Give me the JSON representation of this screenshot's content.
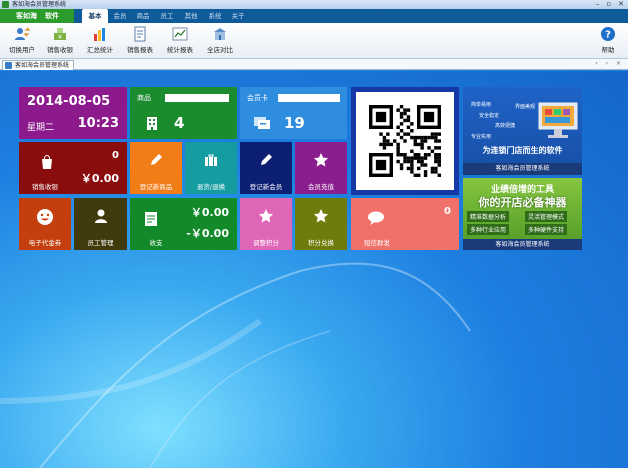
{
  "window": {
    "title": "客如海会员管理系统",
    "controls": [
      "–",
      "▫",
      "✕"
    ]
  },
  "brand": {
    "name": "客如海",
    "suffix": "软件"
  },
  "menu": [
    "基本",
    "会员",
    "商品",
    "员工",
    "其他",
    "系统",
    "关于"
  ],
  "toolbar": {
    "items": [
      "切换用户",
      "销售收银",
      "汇总统计",
      "销售报表",
      "统计报表",
      "全店对比"
    ],
    "help": "帮助"
  },
  "doc_tab": {
    "label": "客如海会员管理系统",
    "nav": "‹ › ×"
  },
  "tiles": {
    "date": {
      "date": "2014-08-05",
      "weekday": "星期二",
      "time": "10:23"
    },
    "goods": {
      "label": "商品",
      "count": "4"
    },
    "card": {
      "label": "会员卡",
      "count": "19"
    },
    "cashier": {
      "label": "销售收银",
      "count": "0",
      "amount": "￥0.00"
    },
    "register_goods": {
      "label": "登记新商品"
    },
    "return_goods": {
      "label": "退货/退换"
    },
    "register_member": {
      "label": "登记新会员"
    },
    "recharge": {
      "label": "会员充值"
    },
    "ecoupon": {
      "label": "电子代金券"
    },
    "staff": {
      "label": "员工管理"
    },
    "income": {
      "label": "收支",
      "plus": "￥0.00",
      "minus": "-￥0.00"
    },
    "points_adjust": {
      "label": "调整积分"
    },
    "points_exchange": {
      "label": "积分兑换"
    },
    "sms": {
      "label": "短信群发",
      "count": "0"
    }
  },
  "ad1": {
    "words": [
      "简单易用",
      "界面美观",
      "安全稳定",
      "高效便捷",
      "专业实用"
    ],
    "slogan": "为连锁门店而生的软件",
    "footer": "客如海会员管理系统"
  },
  "ad2": {
    "line1": "业绩倍增的工具",
    "line2": "你的开店必备神器",
    "features": [
      "精准数据分析",
      "灵活管理模式",
      "多种行业应用",
      "多种硬件支持"
    ],
    "footer": "客如海会员管理系统"
  }
}
